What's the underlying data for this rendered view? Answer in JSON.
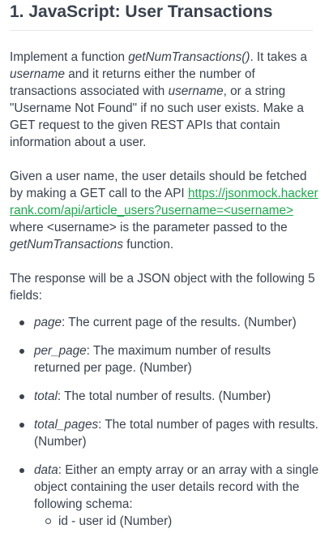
{
  "title": "1. JavaScript: User Transactions",
  "intro": {
    "t1": "Implement a function ",
    "fn": "getNumTransactions()",
    "t2": ". It takes a ",
    "username1": "username",
    "t3": " and it returns either the number of transactions associated with ",
    "username2": "username",
    "t4": ", or a string \"Username Not Found\" if no such user exists. Make a GET request to the given REST APIs that contain information about a user."
  },
  "details": {
    "t1": "Given a user name, the user details should be fetched by making a GET call to the API ",
    "link": "https://jsonmock.hackerrank.com/api/article_users?username=<username>",
    "t2": " where <username> is the parameter passed to the ",
    "fn": "getNumTransactions",
    "t3": " function."
  },
  "response": {
    "text": "The response will be a JSON object with the following 5 fields:"
  },
  "fields": [
    {
      "name": "page",
      "desc": ": The current page of the results. (Number)"
    },
    {
      "name": "per_page",
      "desc": ": The maximum number of results returned per page. (Number)"
    },
    {
      "name": "total",
      "desc": ": The total number of results. (Number)"
    },
    {
      "name": "total_pages",
      "desc": ": The total number of pages with results. (Number)"
    },
    {
      "name": "data",
      "desc": ": Either an empty array or an array with a single object containing the user details record with the following schema:"
    }
  ],
  "schema": [
    {
      "text": "id - user id (Number)"
    }
  ]
}
